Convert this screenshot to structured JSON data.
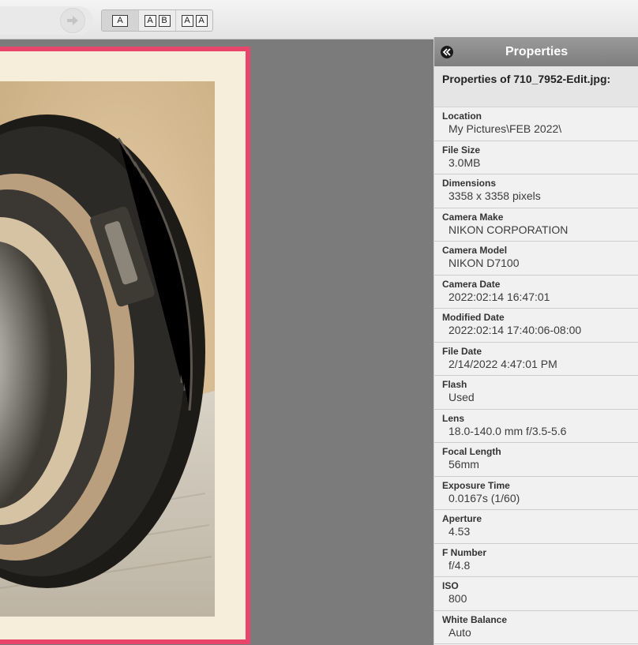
{
  "toolbar": {
    "nav_forward_icon": "arrow-right-icon",
    "view_buttons": [
      {
        "glyphs": [
          "A"
        ],
        "active": true
      },
      {
        "glyphs": [
          "A",
          "B"
        ],
        "active": false
      },
      {
        "glyphs": [
          "A",
          "A"
        ],
        "active": false
      }
    ]
  },
  "panel": {
    "title": "Properties",
    "file_heading": "Properties of 710_7952-Edit.jpg:",
    "properties": [
      {
        "label": "Location",
        "value": "My Pictures\\FEB 2022\\"
      },
      {
        "label": "File Size",
        "value": "3.0MB"
      },
      {
        "label": "Dimensions",
        "value": "3358 x 3358 pixels"
      },
      {
        "label": "Camera Make",
        "value": "NIKON CORPORATION"
      },
      {
        "label": "Camera Model",
        "value": "NIKON D7100"
      },
      {
        "label": "Camera Date",
        "value": "2022:02:14 16:47:01"
      },
      {
        "label": "Modified Date",
        "value": "2022:02:14 17:40:06-08:00"
      },
      {
        "label": "File Date",
        "value": "2/14/2022 4:47:01 PM"
      },
      {
        "label": "Flash",
        "value": "Used"
      },
      {
        "label": "Lens",
        "value": "18.0-140.0 mm f/3.5-5.6"
      },
      {
        "label": "Focal Length",
        "value": "56mm"
      },
      {
        "label": "Exposure Time",
        "value": "0.0167s (1/60)"
      },
      {
        "label": "Aperture",
        "value": "4.53"
      },
      {
        "label": "F Number",
        "value": "f/4.8"
      },
      {
        "label": "ISO",
        "value": "800"
      },
      {
        "label": "White Balance",
        "value": "Auto"
      }
    ]
  },
  "colors": {
    "frame_border": "#e9456a",
    "panel_header": "#8a8a8a",
    "canvas_bg": "#7b7b7b"
  }
}
